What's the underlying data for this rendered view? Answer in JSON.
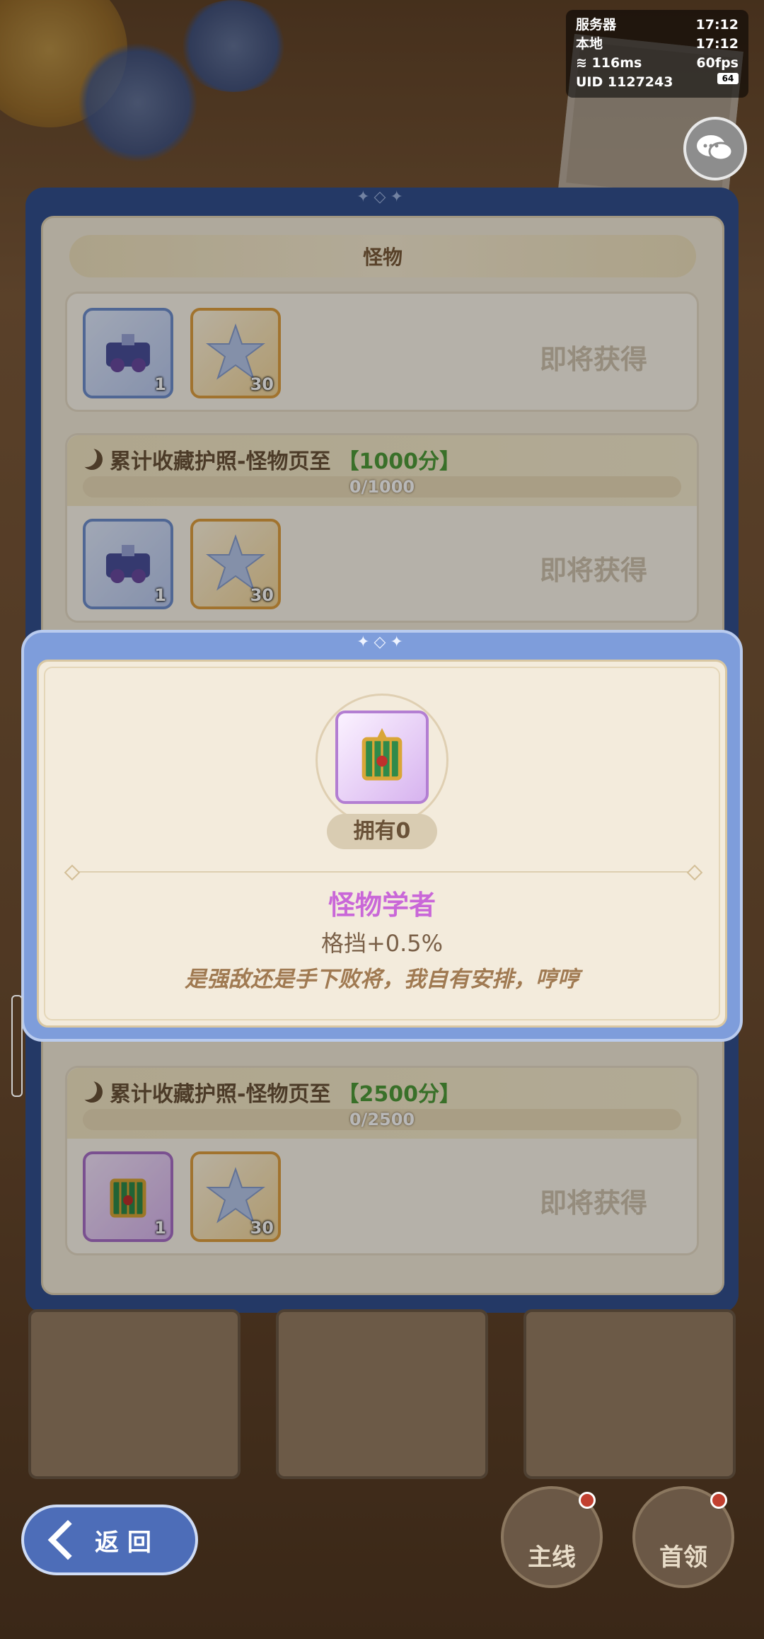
{
  "status": {
    "server_label": "服务器",
    "server_time": "17:12",
    "local_label": "本地",
    "local_time": "17:12",
    "ping": "116ms",
    "fps": "60fps",
    "uid_label": "UID",
    "uid": "1127243",
    "battery": "64"
  },
  "panel": {
    "title": "怪物"
  },
  "rewards": [
    {
      "title": "",
      "target": "",
      "progress_text": "",
      "progress": 0,
      "items": [
        {
          "icon": "mecha-medal-icon",
          "count": "1",
          "style": "blue"
        },
        {
          "icon": "star-crystal-icon",
          "count": "30",
          "style": "orange"
        }
      ],
      "status": "即将获得"
    },
    {
      "title": "累计收藏护照-怪物页至",
      "target": "【1000分】",
      "progress_text": "0/1000",
      "progress": 0,
      "items": [
        {
          "icon": "mecha-medal-icon",
          "count": "1",
          "style": "blue"
        },
        {
          "icon": "star-crystal-icon",
          "count": "30",
          "style": "orange"
        }
      ],
      "status": "即将获得"
    },
    {
      "title": "累计收藏护照-怪物页至",
      "target": "【2500分】",
      "progress_text": "0/2500",
      "progress": 0,
      "items": [
        {
          "icon": "cage-medal-icon",
          "count": "1",
          "style": "purple"
        },
        {
          "icon": "star-crystal-icon",
          "count": "30",
          "style": "orange"
        }
      ],
      "status": "即将获得"
    }
  ],
  "popup": {
    "owned": "拥有0",
    "name": "怪物学者",
    "stat": "格挡+0.5%",
    "quote": "是强敌还是手下败将，我自有安排，哼哼"
  },
  "bottom": {
    "back_label": "返 回",
    "mainline_label": "主线",
    "boss_label": "首领"
  },
  "colors": {
    "accent_blue": "#7e9ddb",
    "popup_name": "#c967d8",
    "progress_green": "#4f9b3a"
  }
}
